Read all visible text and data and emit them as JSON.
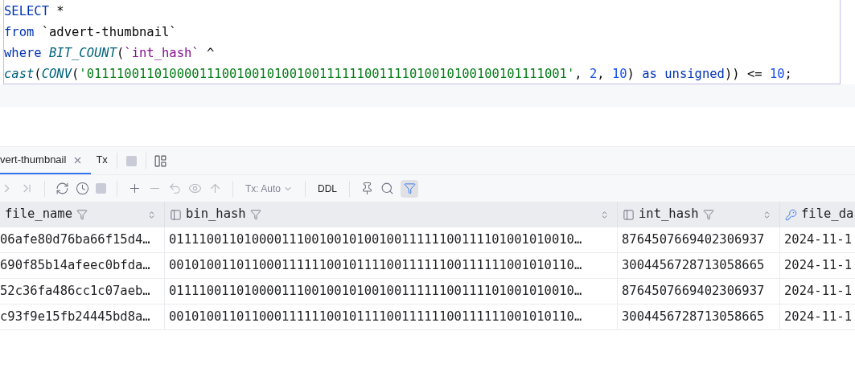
{
  "editor": {
    "lines": [
      [
        {
          "kind": "keyword",
          "text": "SELECT"
        },
        {
          "kind": "plain",
          "text": " *"
        }
      ],
      [
        {
          "kind": "keyword",
          "text": "from"
        },
        {
          "kind": "plain",
          "text": " `advert-thumbnail`"
        }
      ],
      [
        {
          "kind": "keyword",
          "text": "where "
        },
        {
          "kind": "function",
          "text": "BIT_COUNT"
        },
        {
          "kind": "plain",
          "text": "("
        },
        {
          "kind": "identifier",
          "text": "`int_hash`"
        },
        {
          "kind": "plain",
          "text": " ^"
        }
      ],
      [
        {
          "kind": "function",
          "text": "cast"
        },
        {
          "kind": "plain",
          "text": "("
        },
        {
          "kind": "function",
          "text": "CONV"
        },
        {
          "kind": "plain",
          "text": "("
        },
        {
          "kind": "string",
          "text": "'0111100110100001110010010100100111111001111010010100100101111001'"
        },
        {
          "kind": "plain",
          "text": ", "
        },
        {
          "kind": "number",
          "text": "2"
        },
        {
          "kind": "plain",
          "text": ", "
        },
        {
          "kind": "number",
          "text": "10"
        },
        {
          "kind": "plain",
          "text": ") "
        },
        {
          "kind": "keyword",
          "text": "as unsigned"
        },
        {
          "kind": "plain",
          "text": ")) <= "
        },
        {
          "kind": "number",
          "text": "10"
        },
        {
          "kind": "plain",
          "text": ";"
        }
      ]
    ]
  },
  "result_tabs": [
    {
      "label": "vert-thumbnail",
      "selected": true,
      "kind": "result"
    },
    {
      "label": "Tx",
      "selected": false,
      "kind": "tx"
    }
  ],
  "toolbar": {
    "tx_mode": "Tx: Auto",
    "ddl": "DDL",
    "filter_panel_on": true
  },
  "table": {
    "columns": [
      {
        "name": "file_name",
        "kind": "partial"
      },
      {
        "name": "bin_hash",
        "kind": "column"
      },
      {
        "name": "int_hash",
        "kind": "column"
      },
      {
        "name": "file_da",
        "kind": "index"
      }
    ],
    "rows": [
      [
        "06afe80d76ba66f15d4…",
        "011110011010000111001001010010011111100111101001010010…",
        "8764507669402306937",
        "2024-11-1"
      ],
      [
        "690f85b14afeec0bfda…",
        "001010011011000111111001011110011111100111111001010110…",
        "3004456728713058665",
        "2024-11-1"
      ],
      [
        "52c36fa486cc1c07aeb…",
        "011110011010000111001001010010011111100111101001010010…",
        "8764507669402306937",
        "2024-11-1"
      ],
      [
        "c93f9e15fb24445bd8a…",
        "001010011011000111111001011110011111100111111001010110…",
        "3004456728713058665",
        "2024-11-1"
      ]
    ]
  }
}
